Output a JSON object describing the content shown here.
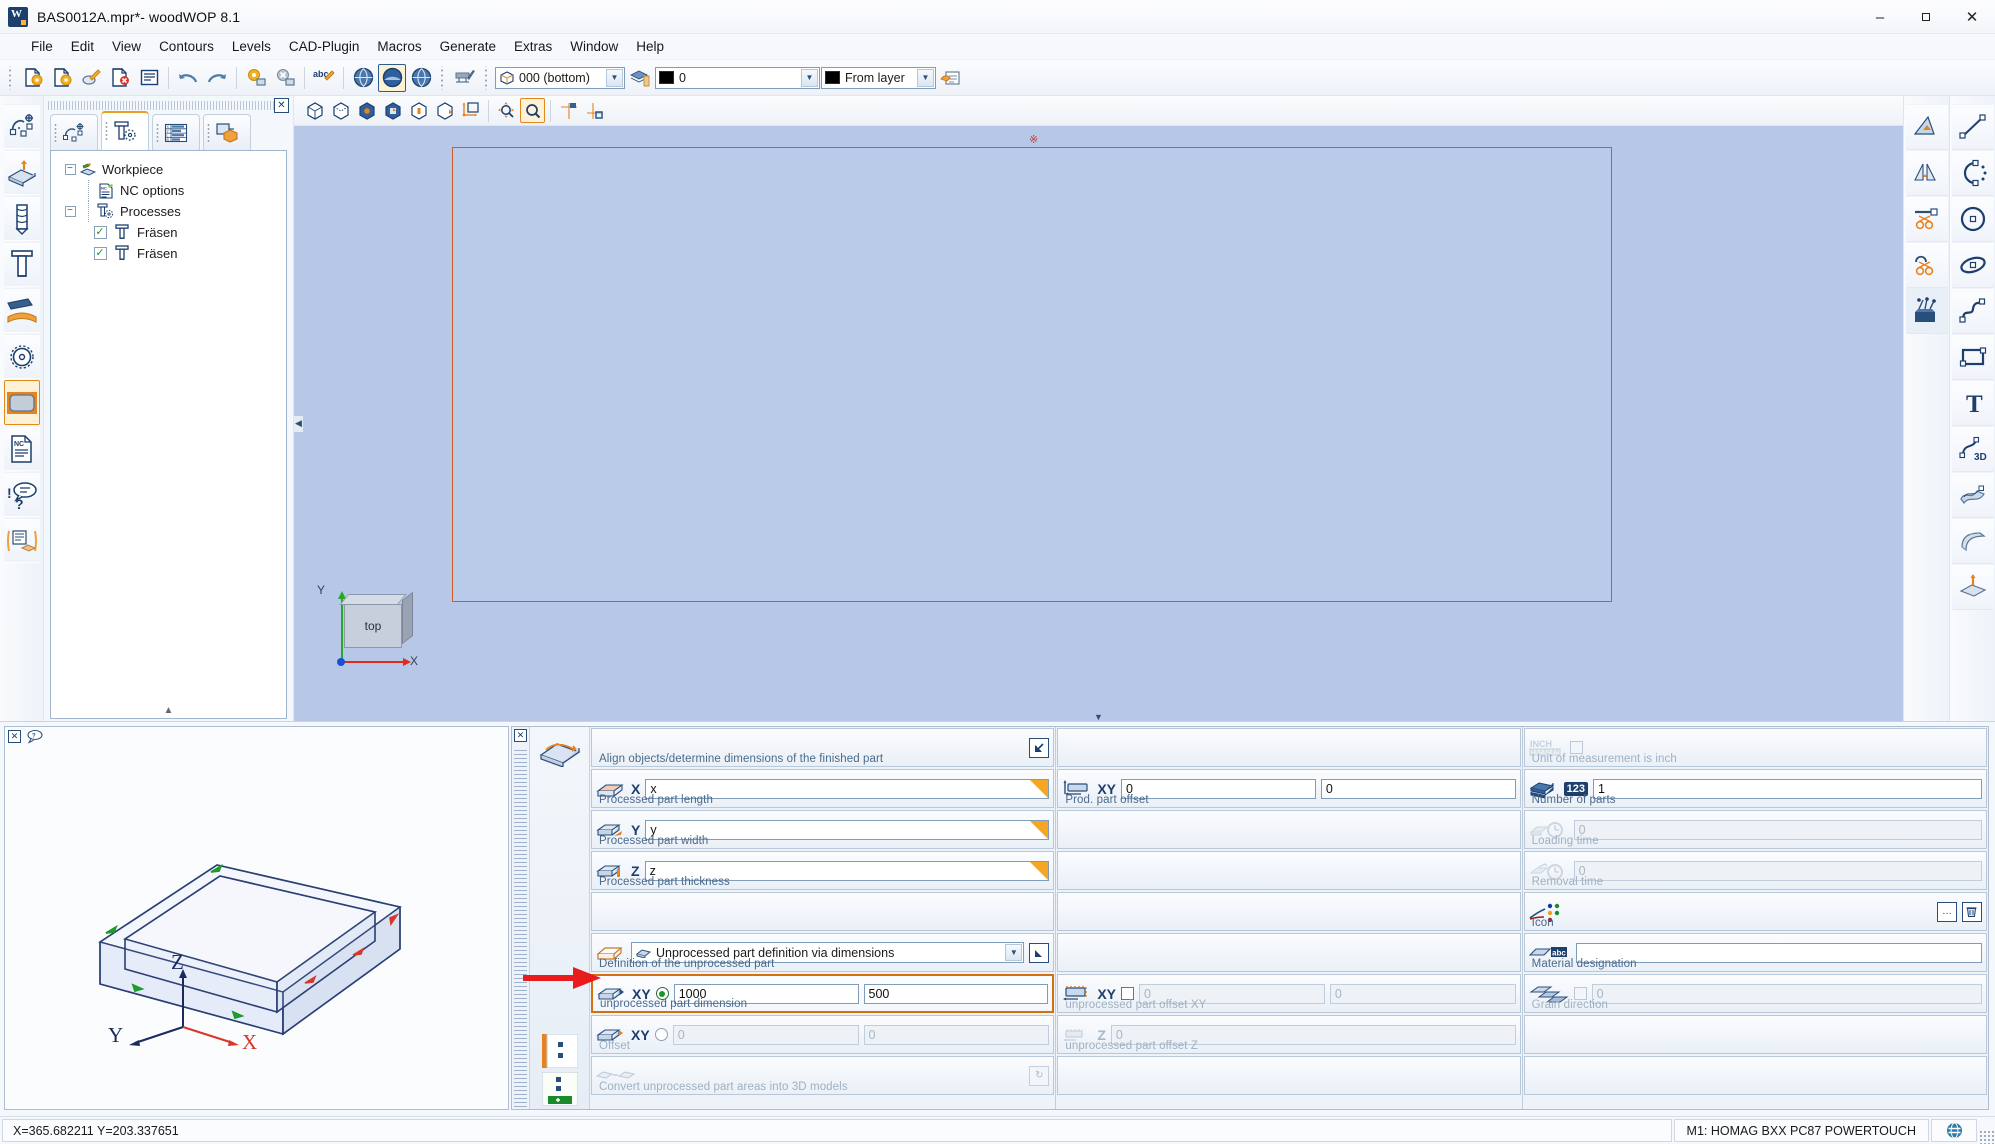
{
  "window": {
    "title": "BAS0012A.mpr*- woodWOP 8.1",
    "app_icon": "woodwop-logo-icon",
    "minimize_label": "–",
    "maximize_label": "❐",
    "close_label": "✕"
  },
  "menu": {
    "items": [
      {
        "label": "File",
        "name": "menu-file"
      },
      {
        "label": "Edit",
        "name": "menu-edit"
      },
      {
        "label": "View",
        "name": "menu-view"
      },
      {
        "label": "Contours",
        "name": "menu-contours"
      },
      {
        "label": "Levels",
        "name": "menu-levels"
      },
      {
        "label": "CAD-Plugin",
        "name": "menu-cad-plugin"
      },
      {
        "label": "Macros",
        "name": "menu-macros"
      },
      {
        "label": "Generate",
        "name": "menu-generate"
      },
      {
        "label": "Extras",
        "name": "menu-extras"
      },
      {
        "label": "Window",
        "name": "menu-window"
      },
      {
        "label": "Help",
        "name": "menu-help"
      }
    ]
  },
  "toolbar": {
    "buttons": [
      {
        "name": "new-file-icon"
      },
      {
        "name": "open-file-icon"
      },
      {
        "name": "edit-file-icon"
      },
      {
        "name": "close-file-icon"
      },
      {
        "name": "list-view-icon"
      },
      {
        "name": "undo-icon"
      },
      {
        "name": "redo-icon"
      },
      {
        "name": "save-settings-icon"
      },
      {
        "name": "delete-settings-icon"
      },
      {
        "name": "spellcheck-abc-icon"
      },
      {
        "name": "globe-left-icon"
      },
      {
        "name": "globe-center-icon"
      },
      {
        "name": "globe-right-icon"
      },
      {
        "name": "machine-check-icon"
      }
    ],
    "level_combo": {
      "value": "000  (bottom)",
      "icon": "cube-level-icon",
      "name": "level-select"
    },
    "layer_stack_icon": "layer-stack-icon",
    "color_combo": {
      "value": "0",
      "swatch": "#000000",
      "name": "color-select"
    },
    "linetype_combo": {
      "value": "From layer",
      "swatch": "#000000",
      "name": "linetype-select"
    },
    "properties_icon": "properties-hand-icon"
  },
  "left_rail": {
    "buttons": [
      {
        "name": "rail-contour-icon",
        "selected": false
      },
      {
        "name": "rail-workpiece-icon",
        "selected": false
      },
      {
        "name": "rail-drill-icon",
        "selected": false
      },
      {
        "name": "rail-mill-icon",
        "selected": false
      },
      {
        "name": "rail-saw-blade-angle-icon",
        "selected": false
      },
      {
        "name": "rail-circular-saw-icon",
        "selected": false
      },
      {
        "name": "rail-workpiece-outline-icon",
        "selected": true
      },
      {
        "name": "rail-nc-document-icon",
        "selected": false
      },
      {
        "name": "rail-comment-question-icon",
        "selected": false
      },
      {
        "name": "rail-variables-icon",
        "selected": false
      }
    ]
  },
  "tree_panel": {
    "close_label": "✕",
    "tabs": [
      {
        "name": "tab-contours",
        "icon": "contour-points-icon",
        "active": false
      },
      {
        "name": "tab-processes",
        "icon": "processes-tool-icon",
        "active": true
      },
      {
        "name": "tab-variables",
        "icon": "variables-table-icon",
        "active": false
      },
      {
        "name": "tab-components",
        "icon": "components-3d-icon",
        "active": false
      }
    ],
    "nodes": [
      {
        "label": "Workpiece",
        "level": 0,
        "expander": "−",
        "icon": "workpiece-pencil-icon",
        "checkbox": null
      },
      {
        "label": "NC options",
        "level": 1,
        "expander": null,
        "icon": "nc-options-icon",
        "checkbox": null
      },
      {
        "label": "Processes",
        "level": 1,
        "expander": "−",
        "icon": "processes-tool-icon",
        "checkbox": null
      },
      {
        "label": "Fräsen",
        "level": 2,
        "expander": null,
        "icon": "mill-icon",
        "checkbox": true
      },
      {
        "label": "Fräsen",
        "level": 2,
        "expander": null,
        "icon": "mill-icon",
        "checkbox": true
      }
    ],
    "scroll_down": "▲"
  },
  "view_toolbar": {
    "buttons": [
      {
        "name": "view-wireframe-icon"
      },
      {
        "name": "view-hidden-line-icon"
      },
      {
        "name": "view-shaded-icon"
      },
      {
        "name": "view-shaded-edges-icon"
      },
      {
        "name": "view-transparent-icon"
      },
      {
        "name": "view-section-icon"
      },
      {
        "name": "view-move-origin-icon"
      },
      {
        "name": "zoom-pan-icon"
      },
      {
        "name": "zoom-window-icon",
        "active": true
      },
      {
        "name": "grid-snap-top-icon"
      },
      {
        "name": "grid-snap-bottom-icon"
      }
    ]
  },
  "viewport": {
    "origin_marker": "※",
    "axis_widget": {
      "face_label": "top",
      "x_label": "X",
      "y_label": "Y",
      "x_color": "#e02b1c",
      "y_color": "#28a828"
    },
    "workpiece_border_color": "#cf5a2a",
    "background_color": "#b7c7e8",
    "collapse_left": "◀",
    "collapse_bottom": "▼"
  },
  "right_rail_inner": {
    "buttons": [
      {
        "name": "measure-angle-icon"
      },
      {
        "name": "measure-mirror-icon"
      },
      {
        "name": "trim-cut-icon"
      },
      {
        "name": "split-cut-icon"
      },
      {
        "name": "toolbox-icon",
        "selected": true
      }
    ]
  },
  "right_rail_outer": {
    "buttons": [
      {
        "name": "draw-line-icon"
      },
      {
        "name": "draw-arc-icon"
      },
      {
        "name": "draw-circle-icon"
      },
      {
        "name": "draw-ellipse-icon"
      },
      {
        "name": "draw-spline-icon"
      },
      {
        "name": "draw-rectangle-icon"
      },
      {
        "name": "draw-text-icon"
      },
      {
        "name": "draw-3d-contour-icon"
      },
      {
        "name": "draw-freeform-surface-icon"
      },
      {
        "name": "draw-tube-surface-icon"
      },
      {
        "name": "draw-extrude-icon"
      }
    ]
  },
  "preview_panel": {
    "close_label": "✕",
    "help_icon": "preview-help-icon",
    "axis_labels": {
      "x": "X",
      "y": "Y",
      "z": "Z"
    }
  },
  "params": {
    "gutter_icons": [
      {
        "name": "param-list-icon"
      },
      {
        "name": "param-add-icon"
      }
    ],
    "header_icon": "finished-part-align-icon",
    "columns": [
      {
        "name": "column-finished-part",
        "rows": [
          {
            "name": "row-align-objects",
            "caption": "Align objects/determine dimensions of the finished part",
            "type": "header",
            "icon": "align-objects-icon",
            "jump_icon": "jump-arrow-icon",
            "disabled": false
          },
          {
            "name": "row-processed-part-length",
            "caption": "Processed part length",
            "type": "single",
            "tag": "X",
            "icon": "part-length-icon",
            "value": "x",
            "corner": true,
            "disabled": false
          },
          {
            "name": "row-processed-part-width",
            "caption": "Processed part width",
            "type": "single",
            "tag": "Y",
            "icon": "part-width-icon",
            "value": "y",
            "corner": true,
            "disabled": false
          },
          {
            "name": "row-processed-part-thickness",
            "caption": "Processed part thickness",
            "type": "single",
            "tag": "Z",
            "icon": "part-thickness-icon",
            "value": "z",
            "corner": true,
            "disabled": false
          },
          {
            "name": "row-spacer-1",
            "type": "empty"
          },
          {
            "name": "row-unprocessed-part-definition",
            "caption": "Definition of the unprocessed part",
            "type": "combo",
            "icon": "unprocessed-part-icon",
            "value": "Unprocessed part definition via dimensions",
            "combo_icon": "board-icon",
            "jump_icon": "jump-arrow-icon",
            "disabled": false
          },
          {
            "name": "row-unprocessed-part-dimension",
            "caption": "unprocessed part dimension",
            "type": "dual-radio",
            "tag": "XY",
            "icon": "unprocessed-dim-icon",
            "radio": "on",
            "value1": "1000",
            "value2": "500",
            "highlight": true,
            "disabled": false
          },
          {
            "name": "row-offset",
            "caption": "Offset",
            "type": "dual-radio",
            "tag": "XY",
            "icon": "unprocessed-offset-icon",
            "radio": "off",
            "value1": "0",
            "value2": "0",
            "disabled": true
          },
          {
            "name": "row-convert-3d-models",
            "caption": "Convert unprocessed part areas into 3D models",
            "type": "action",
            "icon": "convert-3d-icon",
            "action_icon": "refresh-icon",
            "disabled": true
          }
        ]
      },
      {
        "name": "column-offsets",
        "rows": [
          {
            "name": "row-spacer-m0",
            "type": "empty"
          },
          {
            "name": "row-prod-part-offset",
            "caption": "Prod. part offset",
            "type": "dual",
            "tag": "XY",
            "icon": "prod-offset-icon",
            "value1": "0",
            "value2": "0",
            "disabled": false
          },
          {
            "name": "row-spacer-m1",
            "type": "empty"
          },
          {
            "name": "row-spacer-m2",
            "type": "empty"
          },
          {
            "name": "row-spacer-m3",
            "type": "empty"
          },
          {
            "name": "row-spacer-m4",
            "type": "empty"
          },
          {
            "name": "row-unprocessed-part-offset-xy",
            "caption": "unprocessed part offset XY",
            "type": "dual-check",
            "tag": "XY",
            "icon": "unproc-offset-xy-icon",
            "checkbox": false,
            "value1": "0",
            "value2": "0",
            "disabled": true
          },
          {
            "name": "row-unprocessed-part-offset-z",
            "caption": "unprocessed part offset Z",
            "type": "single",
            "tag": "Z",
            "icon": "unproc-offset-z-icon",
            "value": "0",
            "disabled": true
          },
          {
            "name": "row-spacer-m5",
            "type": "empty"
          }
        ]
      },
      {
        "name": "column-part-info",
        "rows": [
          {
            "name": "row-unit-inch",
            "caption": "Unit of measurement is inch",
            "type": "check",
            "icon": "inch-ruler-icon",
            "checkbox": false,
            "disabled": true
          },
          {
            "name": "row-number-of-parts",
            "caption": "Number of parts",
            "type": "single",
            "tag": "123",
            "icon": "stack-parts-icon",
            "value": "1",
            "disabled": false
          },
          {
            "name": "row-loading-time",
            "caption": "Loading time",
            "type": "single",
            "icon": "loading-time-icon",
            "value": "0",
            "disabled": true
          },
          {
            "name": "row-removal-time",
            "caption": "Removal time",
            "type": "single",
            "icon": "removal-time-icon",
            "value": "0",
            "disabled": true
          },
          {
            "name": "row-icon",
            "caption": "Icon",
            "type": "icon-picker",
            "icon": "palette-icon",
            "browse_label": "…",
            "clear_icon": "trash-icon",
            "disabled": false
          },
          {
            "name": "row-material-designation",
            "caption": "Material designation",
            "type": "text",
            "icon": "material-abc-icon",
            "value": "",
            "disabled": false
          },
          {
            "name": "row-grain-direction",
            "caption": "Grain direction",
            "type": "check-value",
            "icon": "grain-direction-icon",
            "checkbox": false,
            "value": "0",
            "disabled": true
          },
          {
            "name": "row-spacer-r1",
            "type": "empty"
          },
          {
            "name": "row-spacer-r2",
            "type": "empty"
          }
        ]
      }
    ]
  },
  "statusbar": {
    "coordinates": "X=365.682211 Y=203.337651",
    "machine": "M1: HOMAG BXX PC87 POWERTOUCH",
    "status_icon": "connection-icon"
  }
}
